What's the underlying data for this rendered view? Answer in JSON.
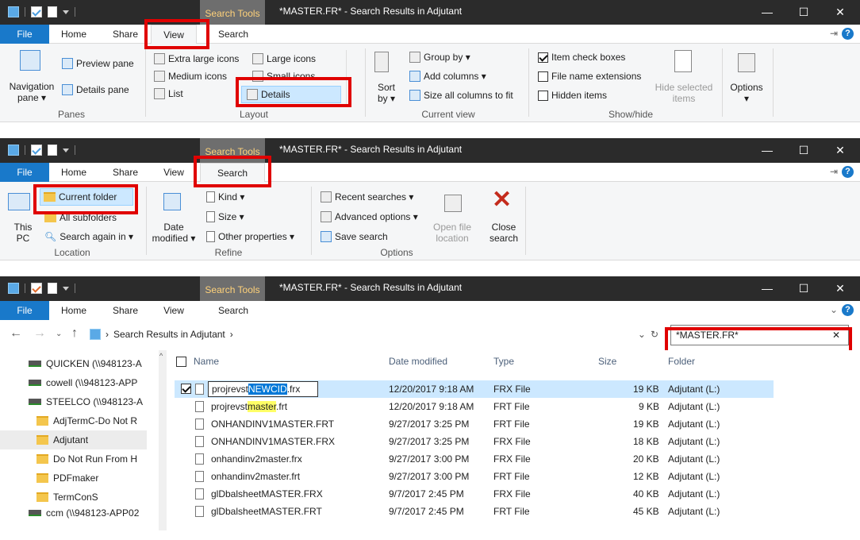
{
  "colors": {
    "file_tab": "#1979ca",
    "red_highlight": "#e00000",
    "selection": "#cce8ff",
    "title_bar": "#2b2b2b"
  },
  "window": {
    "title": "*MASTER.FR* - Search Results in Adjutant",
    "context_tab": "Search Tools",
    "minimize": "—",
    "maximize": "☐",
    "close": "✕"
  },
  "tabs": {
    "file": "File",
    "home": "Home",
    "share": "Share",
    "view": "View",
    "search": "Search"
  },
  "view_ribbon": {
    "panes": {
      "navigation_pane": "Navigation pane ▾",
      "preview_pane": "Preview pane",
      "details_pane": "Details pane",
      "group": "Panes"
    },
    "layout": {
      "extra_large": "Extra large icons",
      "large": "Large icons",
      "medium": "Medium icons",
      "small": "Small icons",
      "list": "List",
      "details": "Details",
      "group": "Layout"
    },
    "current_view": {
      "sort_by": "Sort by ▾",
      "group_by": "Group by ▾",
      "add_columns": "Add columns ▾",
      "size_all": "Size all columns to fit",
      "group": "Current view"
    },
    "show_hide": {
      "item_checkboxes": "Item check boxes",
      "file_name_ext": "File name extensions",
      "hidden_items": "Hidden items",
      "hide_selected": "Hide selected items",
      "group": "Show/hide"
    },
    "options": "Options ▾"
  },
  "search_ribbon": {
    "location": {
      "this_pc": "This PC",
      "current_folder": "Current folder",
      "all_subfolders": "All subfolders",
      "search_again": "Search again in ▾",
      "group": "Location"
    },
    "refine": {
      "date_modified": "Date modified ▾",
      "kind": "Kind ▾",
      "size": "Size ▾",
      "other_props": "Other properties ▾",
      "group": "Refine"
    },
    "options": {
      "recent": "Recent searches ▾",
      "advanced": "Advanced options ▾",
      "save": "Save search",
      "open_location": "Open file location",
      "close_search": "Close search",
      "group": "Options"
    }
  },
  "address": {
    "path": "Search Results in Adjutant",
    "search_value": "*MASTER.FR*",
    "sep": "›"
  },
  "tree": [
    {
      "label": "QUICKEN (\\\\948123-A",
      "icon": "drive"
    },
    {
      "label": "cowell (\\\\948123-APP",
      "icon": "drive"
    },
    {
      "label": "STEELCO (\\\\948123-A",
      "icon": "drive"
    },
    {
      "label": "AdjTermC-Do Not R",
      "icon": "folder"
    },
    {
      "label": "Adjutant",
      "icon": "folder"
    },
    {
      "label": "Do Not Run From H",
      "icon": "folder"
    },
    {
      "label": "PDFmaker",
      "icon": "folder"
    },
    {
      "label": "TermConS",
      "icon": "folder"
    },
    {
      "label": "ccm (\\\\948123-APP02",
      "icon": "drive"
    }
  ],
  "columns": {
    "name": "Name",
    "date": "Date modified",
    "type": "Type",
    "size": "Size",
    "folder": "Folder"
  },
  "files": [
    {
      "pre": "projrevst",
      "hl": "NEWCID",
      "post": ".frx",
      "date": "12/20/2017 9:18 AM",
      "type": "FRX File",
      "size": "19 KB",
      "folder": "Adjutant (L:)"
    },
    {
      "pre": "projrevst",
      "hl": "master",
      "post": ".frt",
      "date": "12/20/2017 9:18 AM",
      "type": "FRT File",
      "size": "9 KB",
      "folder": "Adjutant (L:)"
    },
    {
      "name": "ONHANDINV1MASTER.FRT",
      "date": "9/27/2017 3:25 PM",
      "type": "FRT File",
      "size": "19 KB",
      "folder": "Adjutant (L:)"
    },
    {
      "name": "ONHANDINV1MASTER.FRX",
      "date": "9/27/2017 3:25 PM",
      "type": "FRX File",
      "size": "18 KB",
      "folder": "Adjutant (L:)"
    },
    {
      "name": "onhandinv2master.frx",
      "date": "9/27/2017 3:00 PM",
      "type": "FRX File",
      "size": "20 KB",
      "folder": "Adjutant (L:)"
    },
    {
      "name": "onhandinv2master.frt",
      "date": "9/27/2017 3:00 PM",
      "type": "FRT File",
      "size": "12 KB",
      "folder": "Adjutant (L:)"
    },
    {
      "name": "glDbalsheetMASTER.FRX",
      "date": "9/7/2017 2:45 PM",
      "type": "FRX File",
      "size": "40 KB",
      "folder": "Adjutant (L:)"
    },
    {
      "name": "glDbalsheetMASTER.FRT",
      "date": "9/7/2017 2:45 PM",
      "type": "FRT File",
      "size": "45 KB",
      "folder": "Adjutant (L:)"
    }
  ]
}
